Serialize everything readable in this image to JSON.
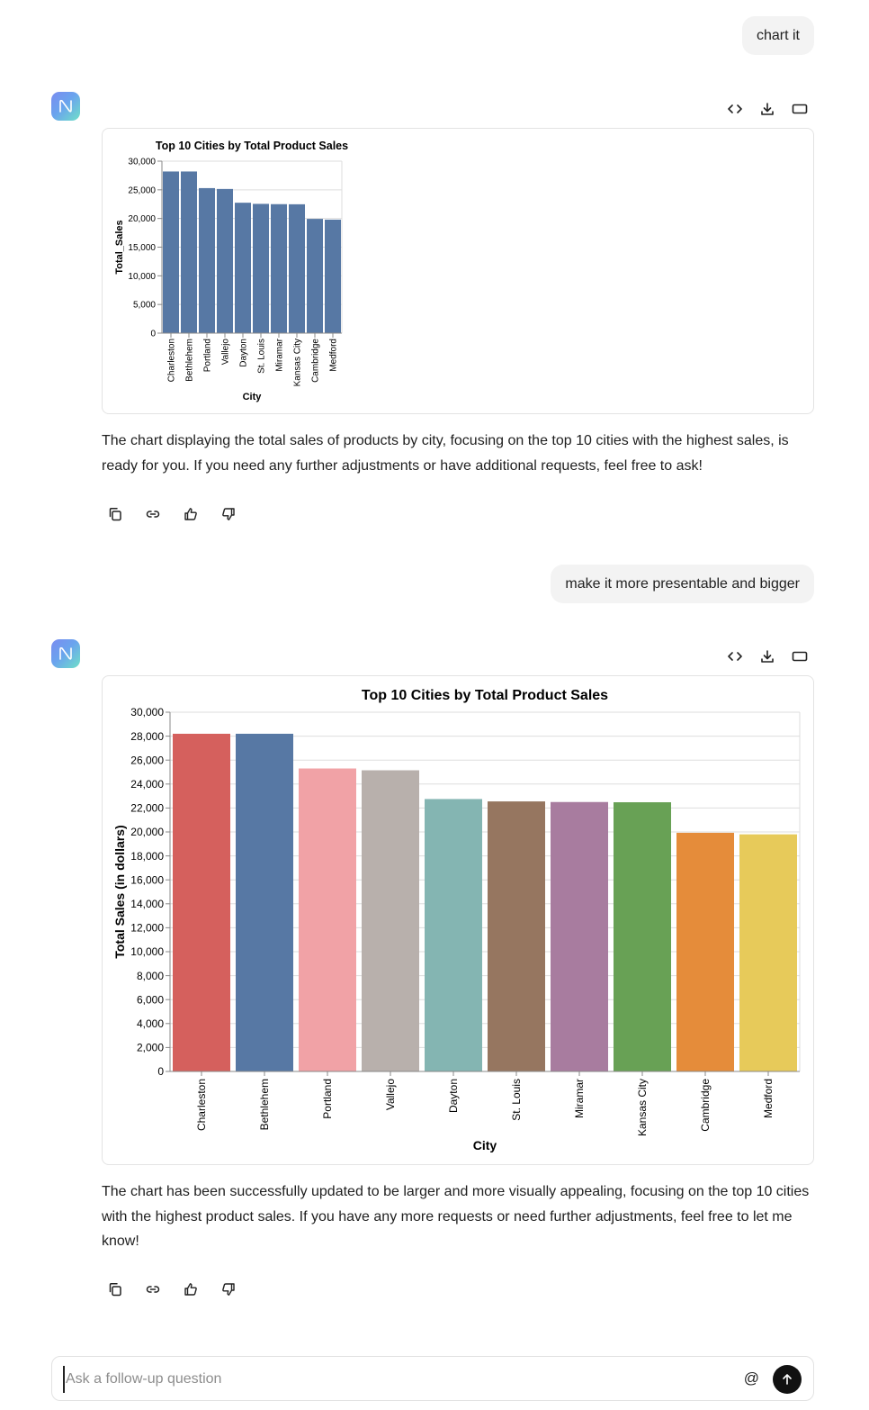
{
  "conversation": {
    "user_messages": [
      "chart it",
      "make it more presentable and bigger"
    ],
    "assistant_messages": [
      "The chart displaying the total sales of products by city, focusing on the top 10 cities with the highest sales, is ready for you. If you need any further adjustments or have additional requests, feel free to ask!",
      "The chart has been successfully updated to be larger and more visually appealing, focusing on the top 10 cities with the highest product sales. If you have any more requests or need further adjustments, feel free to let me know!"
    ]
  },
  "chart_toolbar": {
    "icons": [
      "code-icon",
      "download-icon",
      "expand-icon"
    ]
  },
  "message_actions": {
    "icons": [
      "copy-icon",
      "link-icon",
      "thumbs-up-icon",
      "thumbs-down-icon"
    ]
  },
  "input": {
    "placeholder": "Ask a follow-up question",
    "value": "",
    "mention_label": "@"
  },
  "chart_data": [
    {
      "type": "bar",
      "title": "Top 10 Cities by Total Product Sales",
      "xlabel": "City",
      "ylabel": "Total_Sales",
      "categories": [
        "Charleston",
        "Bethlehem",
        "Portland",
        "Vallejo",
        "Dayton",
        "St. Louis",
        "Miramar",
        "Kansas City",
        "Cambridge",
        "Medford"
      ],
      "values": [
        28200,
        28200,
        25300,
        25150,
        22750,
        22550,
        22500,
        22480,
        19930,
        19800
      ],
      "ylim": [
        0,
        30000
      ],
      "yticks": [
        0,
        5000,
        10000,
        15000,
        20000,
        25000,
        30000
      ],
      "ytick_labels": [
        "0",
        "5,000",
        "10,000",
        "15,000",
        "20,000",
        "25,000",
        "30,000"
      ],
      "grid": true,
      "colors": [
        "#5778a4"
      ],
      "legend": "none"
    },
    {
      "type": "bar",
      "title": "Top 10 Cities by Total Product Sales",
      "xlabel": "City",
      "ylabel": "Total Sales (in dollars)",
      "categories": [
        "Charleston",
        "Bethlehem",
        "Portland",
        "Vallejo",
        "Dayton",
        "St. Louis",
        "Miramar",
        "Kansas City",
        "Cambridge",
        "Medford"
      ],
      "values": [
        28200,
        28200,
        25300,
        25150,
        22750,
        22550,
        22500,
        22480,
        19930,
        19800
      ],
      "ylim": [
        0,
        30000
      ],
      "yticks": [
        0,
        2000,
        4000,
        6000,
        8000,
        10000,
        12000,
        14000,
        16000,
        18000,
        20000,
        22000,
        24000,
        26000,
        28000,
        30000
      ],
      "ytick_labels": [
        "0",
        "2,000",
        "4,000",
        "6,000",
        "8,000",
        "10,000",
        "12,000",
        "14,000",
        "16,000",
        "18,000",
        "20,000",
        "22,000",
        "24,000",
        "26,000",
        "28,000",
        "30,000"
      ],
      "grid": true,
      "colors": [
        "#d5605d",
        "#5778a4",
        "#f1a2a6",
        "#b8b0ac",
        "#84b5b2",
        "#967660",
        "#a87c9f",
        "#68a155",
        "#e58c3a",
        "#e7ca5a"
      ],
      "legend": "none"
    }
  ]
}
